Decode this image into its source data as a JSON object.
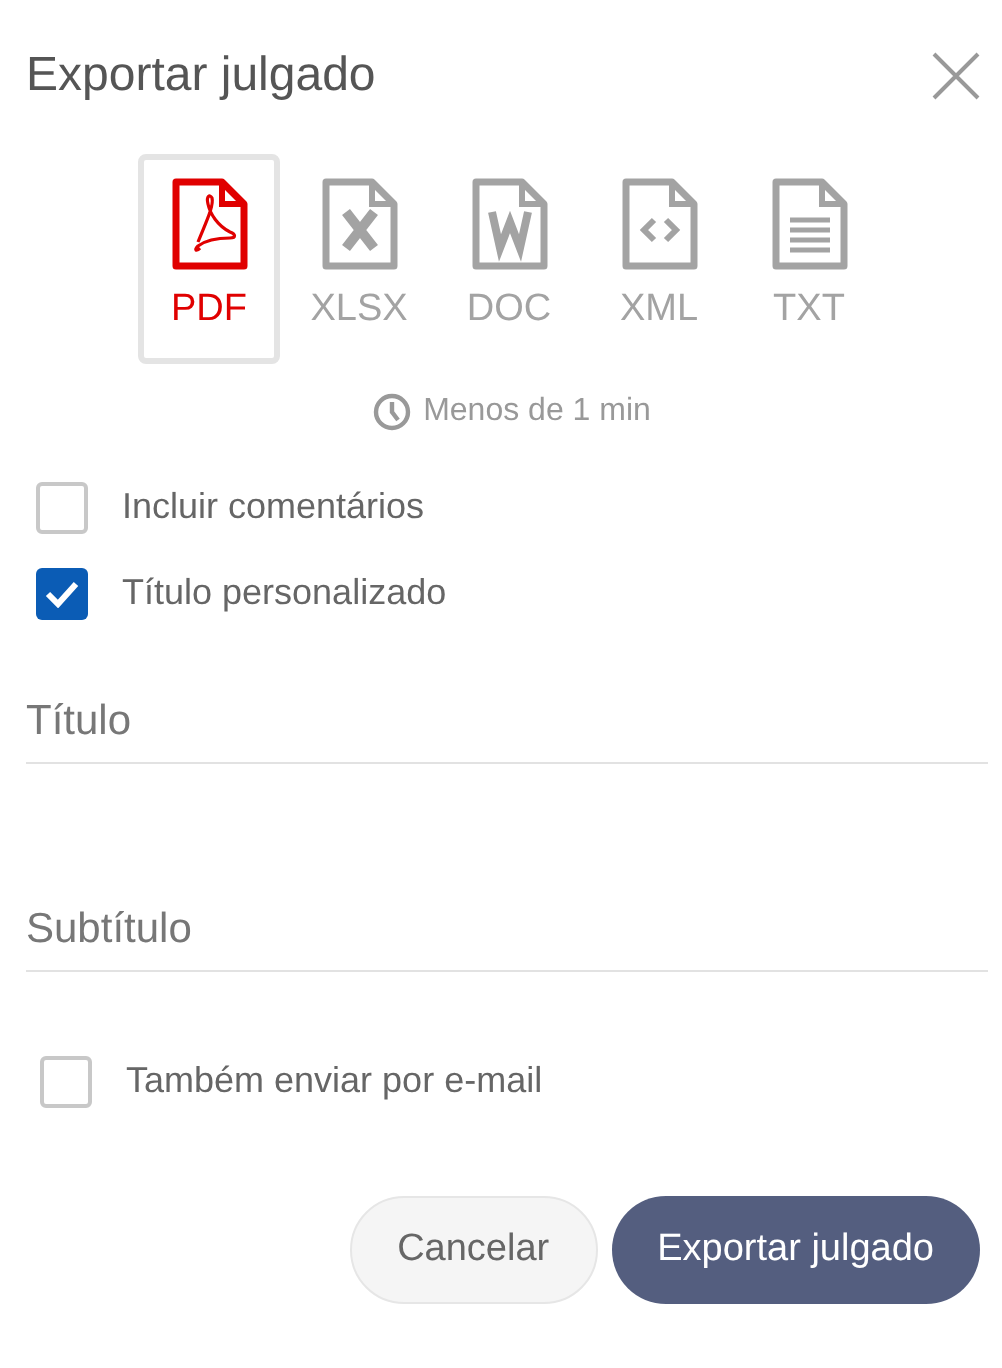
{
  "dialog": {
    "title": "Exportar julgado"
  },
  "formats": [
    {
      "label": "PDF",
      "kind": "pdf",
      "selected": true
    },
    {
      "label": "XLSX",
      "kind": "xlsx",
      "selected": false
    },
    {
      "label": "DOC",
      "kind": "doc",
      "selected": false
    },
    {
      "label": "XML",
      "kind": "xml",
      "selected": false
    },
    {
      "label": "TXT",
      "kind": "txt",
      "selected": false
    }
  ],
  "estimate": "Menos de 1 min",
  "options": [
    {
      "label": "Incluir comentários",
      "checked": false
    },
    {
      "label": "Título personalizado",
      "checked": true
    }
  ],
  "fields": [
    {
      "placeholder": "Título"
    },
    {
      "placeholder": "Subtítulo"
    }
  ],
  "email_option": {
    "label": "Também enviar por e-mail",
    "checked": false
  },
  "buttons": [
    {
      "label": "Cancelar",
      "kind": "secondary"
    },
    {
      "label": "Exportar julgado",
      "kind": "primary"
    }
  ]
}
